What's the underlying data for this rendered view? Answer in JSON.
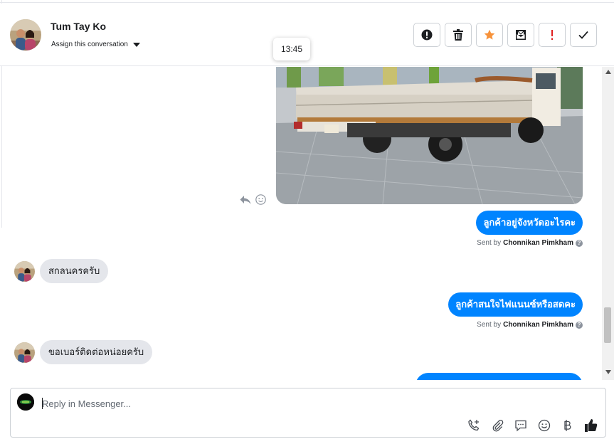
{
  "header": {
    "contact_name": "Tum Tay Ko",
    "assign_label": "Assign this conversation",
    "tooltip_time": "13:45",
    "actions": [
      {
        "name": "spam",
        "icon": "exclamation-circle-icon"
      },
      {
        "name": "delete",
        "icon": "trash-icon"
      },
      {
        "name": "star",
        "icon": "star-icon",
        "color": "#f7923a"
      },
      {
        "name": "mark-unread",
        "icon": "envelope-icon"
      },
      {
        "name": "follow-up",
        "icon": "exclamation-icon",
        "color": "#e02020"
      },
      {
        "name": "done",
        "icon": "check-icon"
      }
    ]
  },
  "thread": {
    "messages": [
      {
        "direction": "out",
        "type": "image",
        "description_icon": "truck-photo"
      },
      {
        "direction": "out",
        "text": "ลูกค้าอยู่จังหวัดอะไรคะ",
        "sent_by_prefix": "Sent by",
        "sent_by": "Chonnikan Pimkham"
      },
      {
        "direction": "in",
        "text": "สกลนครครับ"
      },
      {
        "direction": "out",
        "text": "ลูกค้าสนใจไฟแนนซ์หรือสดคะ",
        "sent_by_prefix": "Sent by",
        "sent_by": "Chonnikan Pimkham"
      },
      {
        "direction": "in",
        "text": "ขอเบอร์ติดต่อหน่อยครับ"
      }
    ]
  },
  "composer": {
    "placeholder": "Reply in Messenger...",
    "tools": [
      "phone-plus-icon",
      "paperclip-icon",
      "chat-bubble-icon",
      "smiley-icon",
      "baht-icon",
      "thumbs-up-icon"
    ]
  },
  "colors": {
    "accent": "#0084ff",
    "incoming_bubble": "#e4e6eb"
  }
}
